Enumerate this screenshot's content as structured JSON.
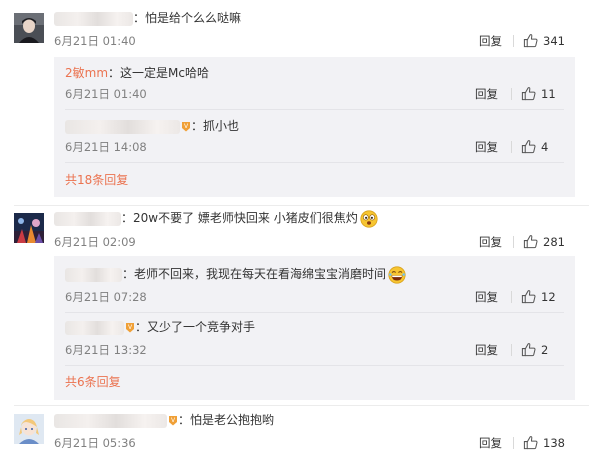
{
  "labels": {
    "reply": "回复"
  },
  "comments": [
    {
      "text": "：怕是给个么么哒嘛",
      "time": "6月21日 01:40",
      "likes": "341",
      "replies": [
        {
          "user": "2敏mm",
          "text": "：这一定是Mc哈哈",
          "time": "6月21日 01:40",
          "likes": "11"
        },
        {
          "user": "",
          "text": "：抓小也",
          "time": "6月21日 14:08",
          "likes": "4"
        }
      ],
      "more": "共18条回复"
    },
    {
      "text": "：20w不要了 嫖老师快回来 小猪皮们很焦灼",
      "time": "6月21日 02:09",
      "likes": "281",
      "replies": [
        {
          "user": "",
          "text": "：老师不回来，我现在每天在看海绵宝宝消磨时间",
          "time": "6月21日 07:28",
          "likes": "12"
        },
        {
          "user": "",
          "text": "：又少了一个竞争对手",
          "time": "6月21日 13:32",
          "likes": "2"
        }
      ],
      "more": "共6条回复"
    },
    {
      "text": "：怕是老公抱抱哟",
      "time": "6月21日 05:36",
      "likes": "138"
    }
  ],
  "icons": {
    "like": "thumbs-up-icon",
    "vip": "verified-badge-icon",
    "emoji": "grimace-emoji-icon"
  }
}
